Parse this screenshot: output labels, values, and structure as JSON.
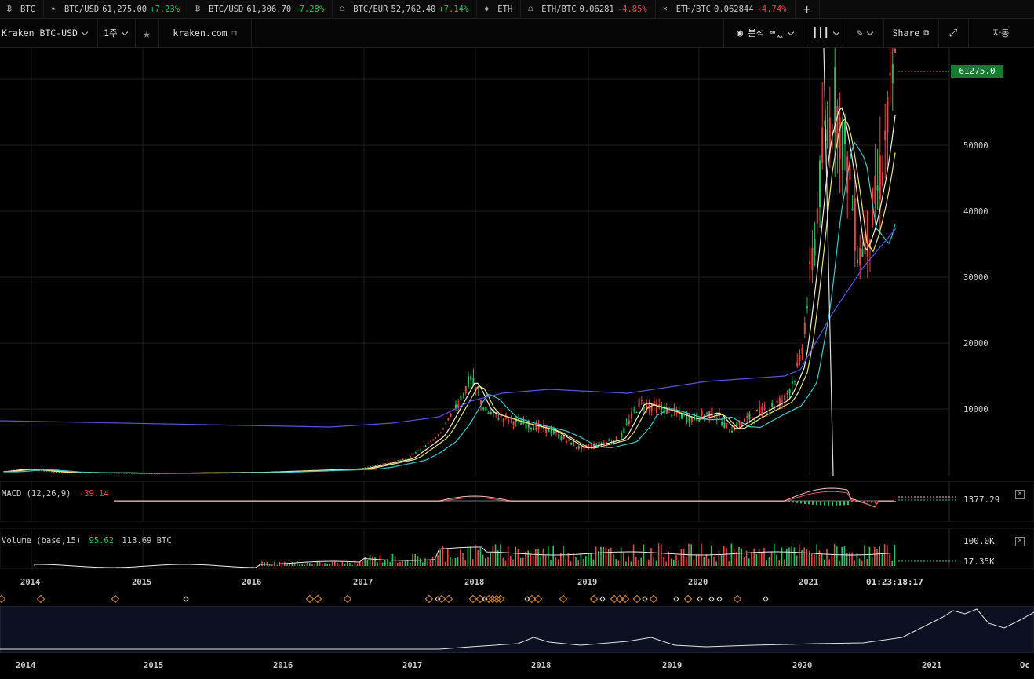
{
  "tickers": [
    {
      "icon": "bitcoin-icon",
      "glyph": "₿",
      "symbol": "BTC",
      "price": "",
      "change": "",
      "dir": ""
    },
    {
      "icon": "leaf-icon",
      "glyph": "❧",
      "symbol": "BTC/USD",
      "price": "61,275.00",
      "change": "+7.23%",
      "dir": "up"
    },
    {
      "icon": "bitcoin-icon",
      "glyph": "₿",
      "symbol": "BTC/USD",
      "price": "61,306.70",
      "change": "+7.28%",
      "dir": "up"
    },
    {
      "icon": "exchange-arch-icon",
      "glyph": "⩍",
      "symbol": "BTC/EUR",
      "price": "52,762.40",
      "change": "+7.14%",
      "dir": "up"
    },
    {
      "icon": "ethereum-icon",
      "glyph": "◆",
      "symbol": "ETH",
      "price": "",
      "change": "",
      "dir": ""
    },
    {
      "icon": "exchange-arch-icon",
      "glyph": "⩍",
      "symbol": "ETH/BTC",
      "price": "0.06281",
      "change": "-4.85%",
      "dir": "dn"
    },
    {
      "icon": "cross-arrows-icon",
      "glyph": "✕",
      "symbol": "ETH/BTC",
      "price": "0.062844",
      "change": "-4.74%",
      "dir": "dn"
    }
  ],
  "toolbar": {
    "symbol": "Kraken BTC-USD",
    "interval": "1주",
    "domain": "kraken.com",
    "analysis": "분석",
    "analysis_sub": "ᄈᆻ",
    "share": "Share",
    "auto": "자동"
  },
  "price_axis": {
    "ticks": [
      "10000",
      "20000",
      "30000",
      "40000",
      "50000"
    ],
    "last_price": "61275.0"
  },
  "macd": {
    "label": "MACD (12,26,9)",
    "value": "-39.14",
    "axis_value": "1377.29"
  },
  "volume": {
    "label": "Volume (base,15)",
    "value1": "95.62",
    "value2": "113.69 BTC",
    "axis_high": "100.0K",
    "axis_low": "17.35K"
  },
  "time_axis": {
    "years": [
      "2014",
      "2015",
      "2016",
      "2017",
      "2018",
      "2019",
      "2020",
      "2021"
    ],
    "countdown": "01:23:18:17"
  },
  "navigator": {
    "years": [
      "2014",
      "2015",
      "2016",
      "2017",
      "2018",
      "2019",
      "2020",
      "2021"
    ],
    "edge_label": "Oc"
  },
  "colors": {
    "up": "#22c55e",
    "down": "#ef4444",
    "price_tag": "#137c2e",
    "ma_white": "#f1f1d0",
    "ma_yellow": "#e8e07a",
    "ma_cyan": "#3fc7c7",
    "ma_blue": "#5b52d8",
    "marker": "#d98a2b"
  }
}
